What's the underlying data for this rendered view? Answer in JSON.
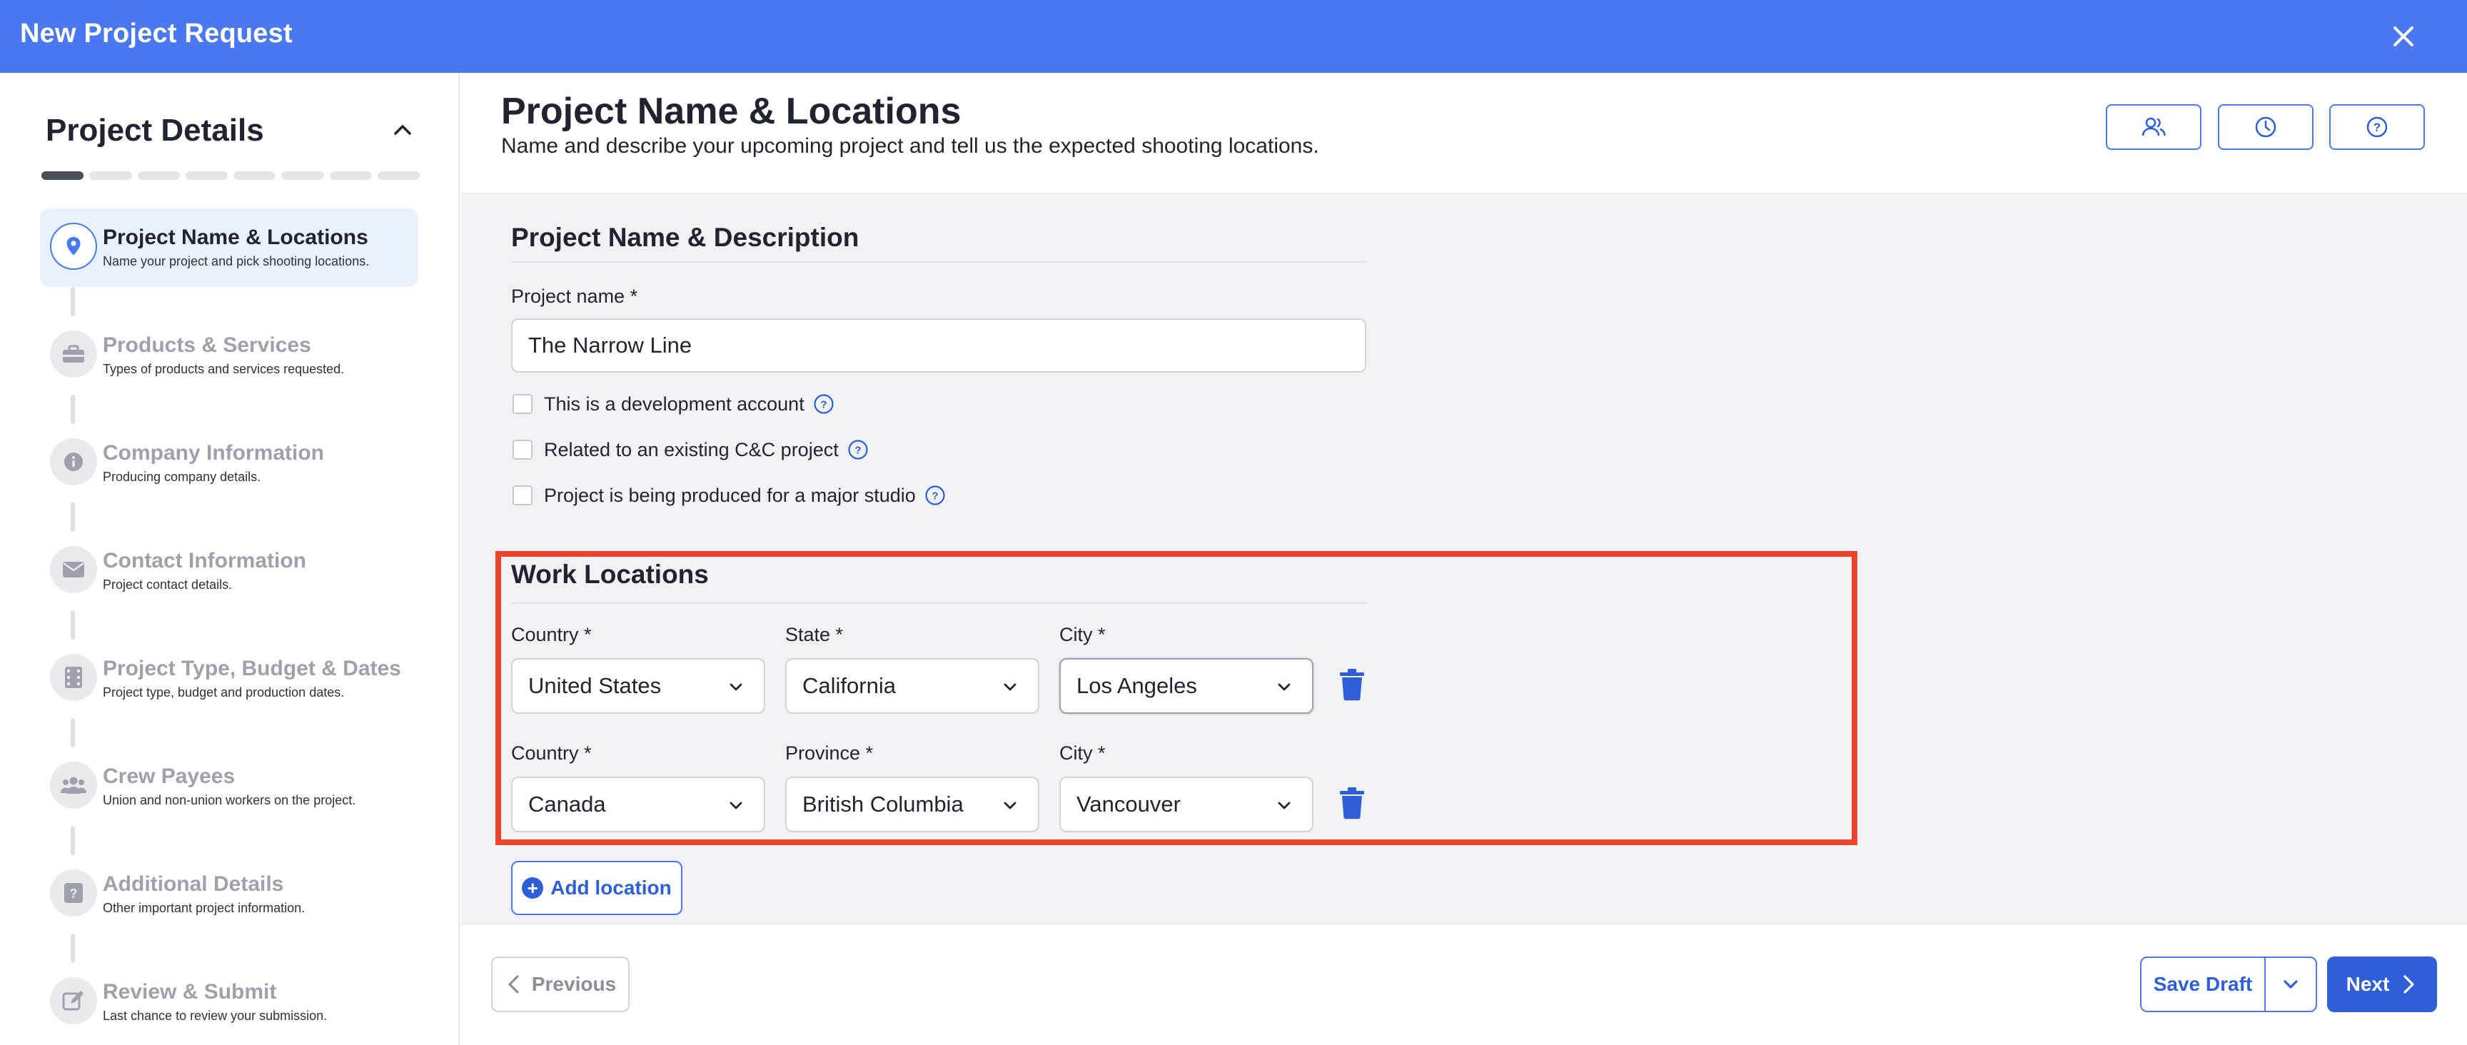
{
  "titlebar": {
    "title": "New Project Request"
  },
  "sidebar": {
    "heading": "Project Details",
    "progress": {
      "total_segments": 8,
      "completed_segments": 1
    },
    "steps": [
      {
        "title": "Project Name & Locations",
        "desc": "Name your project and pick shooting locations.",
        "icon": "location-pin-icon",
        "active": true
      },
      {
        "title": "Products & Services",
        "desc": "Types of products and services requested.",
        "icon": "toolbox-icon",
        "active": false
      },
      {
        "title": "Company Information",
        "desc": "Producing company details.",
        "icon": "info-icon",
        "active": false
      },
      {
        "title": "Contact Information",
        "desc": "Project contact details.",
        "icon": "envelope-icon",
        "active": false
      },
      {
        "title": "Project Type, Budget & Dates",
        "desc": "Project type, budget and production dates.",
        "icon": "film-icon",
        "active": false
      },
      {
        "title": "Crew Payees",
        "desc": "Union and non-union workers on the project.",
        "icon": "people-icon",
        "active": false
      },
      {
        "title": "Additional Details",
        "desc": "Other important project information.",
        "icon": "question-icon",
        "active": false
      },
      {
        "title": "Review & Submit",
        "desc": "Last chance to review your submission.",
        "icon": "edit-icon",
        "active": false
      }
    ]
  },
  "main": {
    "title": "Project Name & Locations",
    "subtitle": "Name and describe your upcoming project and tell us the expected shooting locations.",
    "header_buttons": [
      "users-icon",
      "clock-icon",
      "help-icon"
    ],
    "desc_section": {
      "title": "Project Name & Description",
      "project_name_label": "Project name *",
      "project_name_value": "The Narrow Line",
      "checkboxes": [
        {
          "label": "This is a development account",
          "checked": false
        },
        {
          "label": "Related to an existing C&C project",
          "checked": false
        },
        {
          "label": "Project is being produced for a major studio",
          "checked": false
        }
      ]
    },
    "locations": {
      "title": "Work Locations",
      "rows": [
        {
          "country_label": "Country *",
          "country": "United States",
          "region_label": "State *",
          "region": "California",
          "city_label": "City *",
          "city": "Los Angeles"
        },
        {
          "country_label": "Country *",
          "country": "Canada",
          "region_label": "Province *",
          "region": "British Columbia",
          "city_label": "City *",
          "city": "Vancouver"
        }
      ],
      "add_label": "Add location"
    }
  },
  "footer": {
    "previous": "Previous",
    "save_draft": "Save Draft",
    "next": "Next"
  },
  "colors": {
    "brand_blue": "#4a78f0",
    "button_blue": "#2f5fd8",
    "highlight_red": "#e8432b",
    "content_bg": "#f2f2f6"
  }
}
